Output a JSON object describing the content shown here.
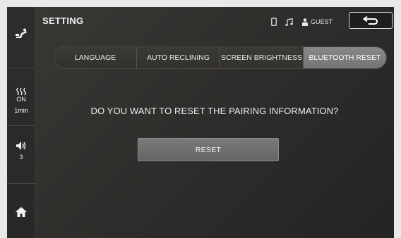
{
  "header": {
    "title": "SETTING",
    "user_label": "GUEST",
    "status_icons": [
      "phone-icon",
      "music-note-icon",
      "person-icon"
    ],
    "back_icon": "back-arrow-icon"
  },
  "sidebar": {
    "heat": {
      "icon": "heat-waves-icon",
      "state": "ON",
      "time": "1min"
    },
    "volume": {
      "icon": "speaker-icon",
      "level": "3"
    },
    "top_icon": "massage-chair-icon",
    "home_icon": "home-icon"
  },
  "tabs": [
    {
      "label": "LANGUAGE",
      "active": false
    },
    {
      "label": "AUTO RECLINING",
      "active": false
    },
    {
      "label": "SCREEN BRIGHTNESS",
      "active": false
    },
    {
      "label": "BLUETOOTH RESET",
      "active": true
    }
  ],
  "main": {
    "question": "DO YOU WANT TO RESET THE PAIRING INFORMATION?",
    "reset_label": "RESET"
  },
  "colors": {
    "background": "#2f2d2b",
    "active_tab": "#7f7d7b",
    "button": "#71706e",
    "text": "#e6e6e6"
  }
}
